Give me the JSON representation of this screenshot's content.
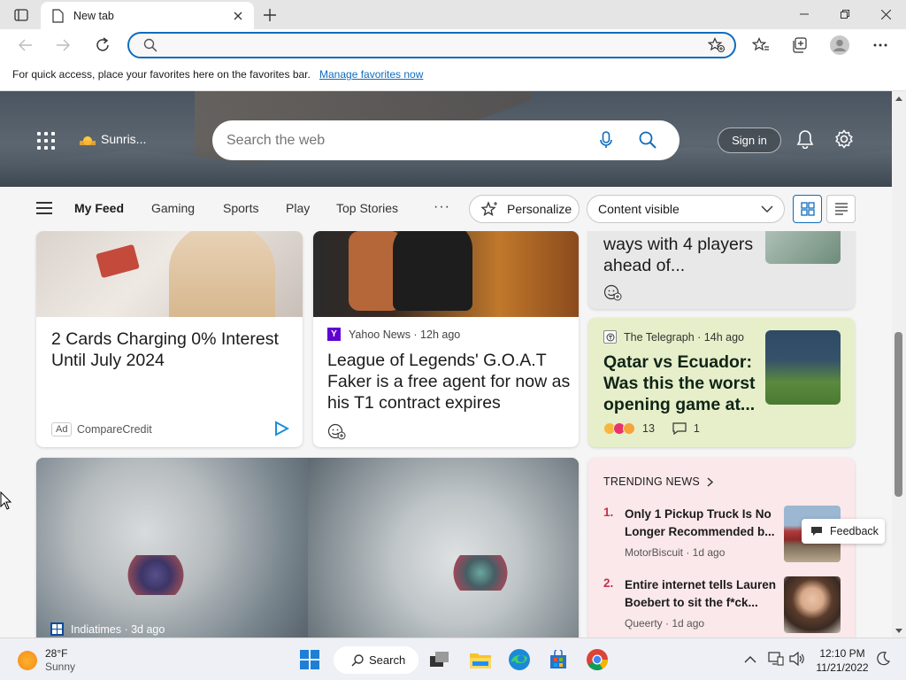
{
  "browser": {
    "tab_title": "New tab",
    "address_placeholder": "",
    "favbar_message": "For quick access, place your favorites here on the favorites bar.",
    "favbar_link": "Manage favorites now"
  },
  "hero": {
    "weather": "Sunris...",
    "search_placeholder": "Search the web",
    "signin": "Sign in"
  },
  "nav": {
    "items": [
      "My Feed",
      "Gaming",
      "Sports",
      "Play",
      "Top Stories"
    ],
    "more": "···",
    "personalize": "Personalize",
    "content_visible": "Content visible"
  },
  "cards": {
    "ad": {
      "headline": "2 Cards Charging 0% Interest Until July 2024",
      "ad_label": "Ad",
      "source": "CompareCredit"
    },
    "yahoo": {
      "source_icon": "Y",
      "source": "Yahoo News · 12h ago",
      "headline": "League of Legends' G.O.A.T Faker is a free agent for now as his T1 contract expires"
    },
    "top_right": {
      "headline": "ways with 4 players ahead of..."
    },
    "telegraph": {
      "source": "The Telegraph · 14h ago",
      "headline": "Qatar vs Ecuador: Was this the worst opening game at...",
      "reactions": "13",
      "comments": "1"
    },
    "indiatimes": {
      "source": "Indiatimes · 3d ago"
    },
    "trending": {
      "heading": "TRENDING NEWS",
      "items": [
        {
          "num": "1.",
          "title": "Only 1 Pickup Truck Is No Longer Recommended b...",
          "meta": "MotorBiscuit · 1d ago"
        },
        {
          "num": "2.",
          "title": "Entire internet tells Lauren Boebert to sit the f*ck...",
          "meta": "Queerty · 1d ago"
        }
      ]
    }
  },
  "feedback": "Feedback",
  "taskbar": {
    "temp": "28°F",
    "condition": "Sunny",
    "search": "Search",
    "time": "12:10 PM",
    "date": "11/21/2022"
  },
  "colors": {
    "accent": "#0f6cbd",
    "trending_number": "#c4314b",
    "telegraph_card": "#e6efc9",
    "trending_card": "#fbe8ea"
  }
}
